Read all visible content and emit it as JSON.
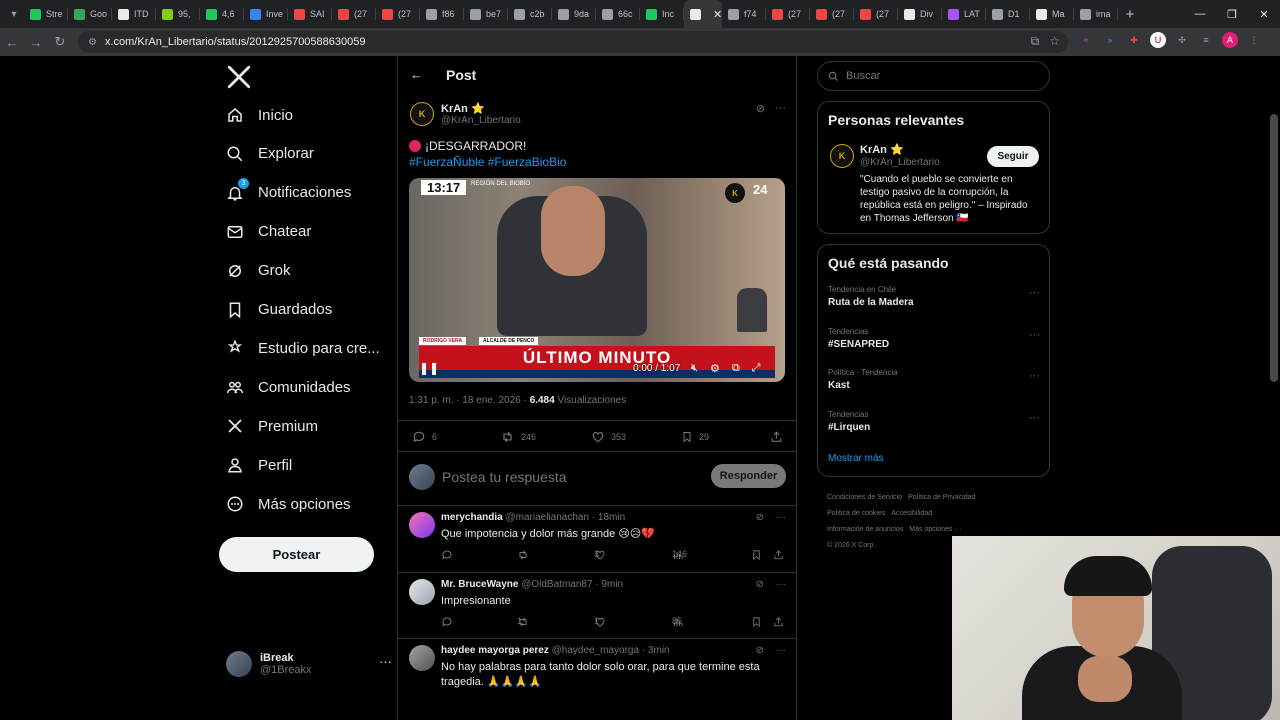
{
  "browser": {
    "tabs": [
      {
        "label": "Stre",
        "color": "#22c55e"
      },
      {
        "label": "Goo",
        "color": "#34a853"
      },
      {
        "label": "ITD",
        "color": "#e8eaed"
      },
      {
        "label": "95,",
        "color": "#84cc16"
      },
      {
        "label": "4,6",
        "color": "#22c55e"
      },
      {
        "label": "Inve",
        "color": "#3b82f6"
      },
      {
        "label": "SAI",
        "color": "#ef4444"
      },
      {
        "label": "(27",
        "color": "#ef4444"
      },
      {
        "label": "(27",
        "color": "#ef4444"
      },
      {
        "label": "f86",
        "color": "#9aa0a6"
      },
      {
        "label": "be7",
        "color": "#9aa0a6"
      },
      {
        "label": "c2b",
        "color": "#9aa0a6"
      },
      {
        "label": "9da",
        "color": "#9aa0a6"
      },
      {
        "label": "66c",
        "color": "#9aa0a6"
      },
      {
        "label": "Inc",
        "color": "#22c55e"
      },
      {
        "label": "",
        "color": "#e8eaed"
      },
      {
        "label": "f74",
        "color": "#9aa0a6"
      },
      {
        "label": "(27",
        "color": "#ef4444"
      },
      {
        "label": "(27",
        "color": "#ef4444"
      },
      {
        "label": "(27",
        "color": "#ef4444"
      },
      {
        "label": "Div",
        "color": "#e8eaed"
      },
      {
        "label": "LAT",
        "color": "#a855f7"
      },
      {
        "label": "D1",
        "color": "#9aa0a6"
      },
      {
        "label": "Ma",
        "color": "#e8eaed"
      },
      {
        "label": "ima",
        "color": "#9aa0a6"
      }
    ],
    "url": "x.com/KrAn_Libertario/status/2012925700588630059"
  },
  "nav": {
    "items": [
      {
        "label": "Inicio",
        "icon": "home-icon"
      },
      {
        "label": "Explorar",
        "icon": "search-icon"
      },
      {
        "label": "Notificaciones",
        "icon": "bell-icon",
        "badge": "3"
      },
      {
        "label": "Chatear",
        "icon": "mail-icon"
      },
      {
        "label": "Grok",
        "icon": "grok-icon"
      },
      {
        "label": "Guardados",
        "icon": "bookmark-icon"
      },
      {
        "label": "Estudio para cre...",
        "icon": "studio-icon"
      },
      {
        "label": "Comunidades",
        "icon": "communities-icon"
      },
      {
        "label": "Premium",
        "icon": "x-icon"
      },
      {
        "label": "Perfil",
        "icon": "profile-icon"
      },
      {
        "label": "Más opciones",
        "icon": "more-icon"
      }
    ],
    "post_button": "Postear",
    "account": {
      "name": "iBreak",
      "handle": "@1Breakx"
    }
  },
  "main": {
    "header_title": "Post",
    "tweet": {
      "avatar_text": "K",
      "name": "KrAn ⭐",
      "handle": "@KrAn_Libertario",
      "text_line1": "¡DESGARRADOR!",
      "text_line2": "#FuerzaÑuble #FuerzaBioBio",
      "video": {
        "clock": "13:17",
        "region": "REGIÓN DEL BIOBÍO",
        "logo": "K",
        "channel": "24",
        "person_name": "RODRIGO VERA",
        "person_role": "ALCALDE DE PENCO",
        "banner": "ÚLTIMO MINUTO",
        "time": "0:00 / 1:07"
      },
      "time": "1:31 p. m. · 18 ene. 2026 ·",
      "views": "6.484",
      "views_label": "Visualizaciones",
      "stats": {
        "replies": "6",
        "reposts": "246",
        "likes": "353",
        "bookmarks": "29"
      }
    },
    "reply_box": {
      "placeholder": "Postea tu respuesta",
      "button": "Responder"
    },
    "replies": [
      {
        "name": "merychandia",
        "handle": "@mariaelianachan",
        "time": "· 18min",
        "text": "Que impotencia y dolor más grande 😢😥💔",
        "reposts": "",
        "likes": "3",
        "views": "146"
      },
      {
        "name": "Mr. BruceWayne",
        "handle": "@OldBatman87",
        "time": "· 9min",
        "text": "Impresionante",
        "reposts": "1",
        "likes": "1",
        "views": "85"
      },
      {
        "name": "haydee mayorga perez",
        "handle": "@haydee_mayorga",
        "time": "· 3min",
        "text": "No hay palabras para tanto dolor solo orar, para que termine esta tragedia. 🙏🙏🙏🙏",
        "reposts": "",
        "likes": "",
        "views": ""
      }
    ]
  },
  "right": {
    "search_placeholder": "Buscar",
    "relevant": {
      "title": "Personas relevantes",
      "avatar_text": "K",
      "name": "KrAn ⭐",
      "handle": "@KrAn_Libertario",
      "follow": "Seguir",
      "bio": "\"Cuando el pueblo se convierte en testigo pasivo de la corrupción, la república está en peligro.\" – Inspirado en Thomas Jefferson 🇨🇱"
    },
    "trending": {
      "title": "Qué está pasando",
      "items": [
        {
          "context": "Tendencia en Chile",
          "name": "Ruta de la Madera"
        },
        {
          "context": "Tendencias",
          "name": "#SENAPRED"
        },
        {
          "context": "Política · Tendencia",
          "name": "Kast"
        },
        {
          "context": "Tendencias",
          "name": "#Lirquen"
        }
      ],
      "show_more": "Mostrar más"
    },
    "footer": [
      "Condiciones de Servicio",
      "Política de Privacidad",
      "Política de cookies",
      "Accesibilidad",
      "Información de anuncios",
      "Más opciones ···",
      "© 2026 X Corp."
    ]
  },
  "colors": {
    "accent": "#1d9bf0",
    "bg": "#000000",
    "muted": "#71767b",
    "border": "#2f3336",
    "like": "#f91880"
  }
}
